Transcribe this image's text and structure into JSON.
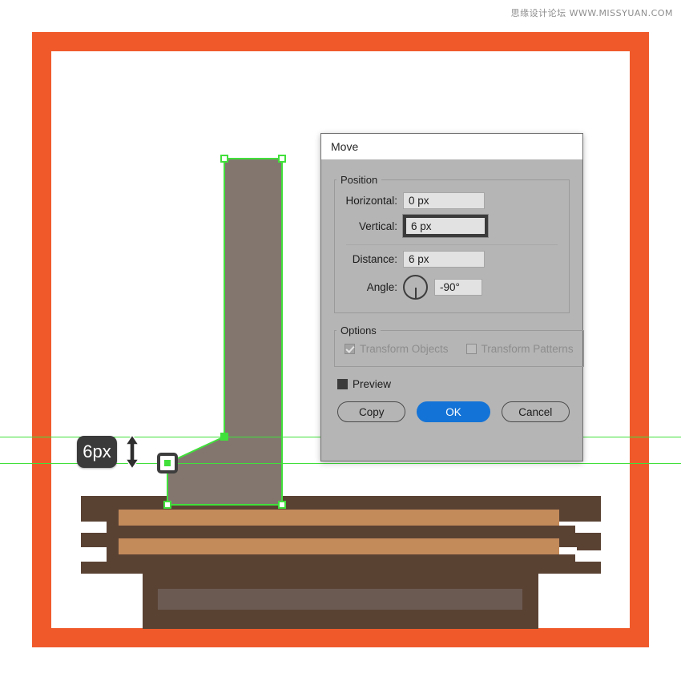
{
  "watermark": {
    "text": "思缘设计论坛  WWW.MISSYUAN.COM"
  },
  "canvas": {
    "frame_color": "#F05A2B",
    "paper_color": "#FFFFFF",
    "guide_color": "#41E03B",
    "shape_fill": "#82766E",
    "bench_dark": "#5A4233",
    "bench_tan": "#C38A5A",
    "bench_mid": "#6B5A52"
  },
  "measurement": {
    "badge_label": "6px",
    "arrow_icon": "double-arrow-vertical-icon"
  },
  "dialog": {
    "title": "Move",
    "position_group": {
      "legend": "Position",
      "horizontal_label": "Horizontal:",
      "horizontal_value": "0 px",
      "vertical_label": "Vertical:",
      "vertical_value": "6 px",
      "distance_label": "Distance:",
      "distance_value": "6 px",
      "angle_label": "Angle:",
      "angle_value": "-90°"
    },
    "options_group": {
      "legend": "Options",
      "transform_objects_label": "Transform Objects",
      "transform_objects_checked": true,
      "transform_patterns_label": "Transform Patterns",
      "transform_patterns_checked": false
    },
    "preview": {
      "label": "Preview",
      "checked": true
    },
    "buttons": {
      "copy": "Copy",
      "ok": "OK",
      "cancel": "Cancel",
      "ok_color": "#1473D6"
    }
  }
}
